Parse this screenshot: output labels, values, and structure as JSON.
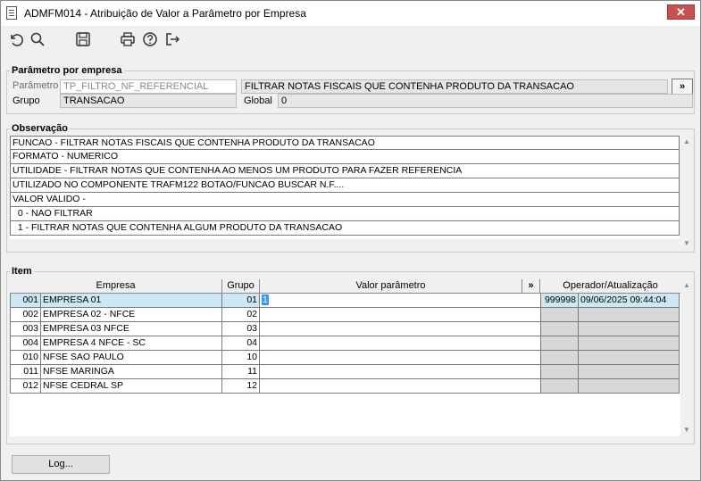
{
  "window": {
    "title": "ADMFM014 - Atribuição de Valor a Parâmetro por Empresa",
    "close_label": "✕"
  },
  "toolbar": {
    "icons": [
      "undo-icon",
      "search-icon",
      "save-icon",
      "print-icon",
      "help-icon",
      "exit-icon"
    ]
  },
  "parametro_por_empresa": {
    "legend": "Parâmetro por empresa",
    "parametro_label": "Parâmetro",
    "parametro_value": "TP_FILTRO_NF_REFERENCIAL",
    "descricao_value": "FILTRAR NOTAS FISCAIS QUE CONTENHA PRODUTO DA TRANSACAO",
    "expand_label": "»",
    "grupo_label": "Grupo",
    "grupo_value": "TRANSACAO",
    "global_label": "Global",
    "global_value": "0"
  },
  "observacao": {
    "legend": "Observação",
    "lines": [
      "FUNCAO - FILTRAR NOTAS FISCAIS QUE CONTENHA PRODUTO DA TRANSACAO",
      "FORMATO - NUMERICO",
      "UTILIDADE - FILTRAR NOTAS QUE CONTENHA AO MENOS UM PRODUTO PARA FAZER REFERENCIA",
      "UTILIZADO NO COMPONENTE TRAFM122 BOTAO/FUNCAO BUSCAR N.F....",
      "VALOR VALIDO -",
      "  0 - NAO FILTRAR",
      "  1 - FILTRAR NOTAS QUE CONTENHA ALGUM PRODUTO DA TRANSACAO"
    ]
  },
  "item": {
    "legend": "Item",
    "headers": {
      "empresa": "Empresa",
      "grupo": "Grupo",
      "valor": "Valor parâmetro",
      "expand": "»",
      "operador": "Operador/Atualização"
    },
    "rows": [
      {
        "codigo": "001",
        "empresa": "EMPRESA 01",
        "grupo": "01",
        "valor": "1",
        "operador": "999998",
        "atualizacao": "09/06/2025 09:44:04"
      },
      {
        "codigo": "002",
        "empresa": "EMPRESA 02 - NFCE",
        "grupo": "02",
        "valor": "",
        "operador": "",
        "atualizacao": ""
      },
      {
        "codigo": "003",
        "empresa": "EMPRESA 03 NFCE",
        "grupo": "03",
        "valor": "",
        "operador": "",
        "atualizacao": ""
      },
      {
        "codigo": "004",
        "empresa": "EMPRESA 4 NFCE - SC",
        "grupo": "04",
        "valor": "",
        "operador": "",
        "atualizacao": ""
      },
      {
        "codigo": "010",
        "empresa": "NFSE SAO PAULO",
        "grupo": "10",
        "valor": "",
        "operador": "",
        "atualizacao": ""
      },
      {
        "codigo": "011",
        "empresa": "NFSE MARINGA",
        "grupo": "11",
        "valor": "",
        "operador": "",
        "atualizacao": ""
      },
      {
        "codigo": "012",
        "empresa": "NFSE CEDRAL SP",
        "grupo": "12",
        "valor": "",
        "operador": "",
        "atualizacao": ""
      }
    ]
  },
  "footer": {
    "log_label": "Log..."
  }
}
